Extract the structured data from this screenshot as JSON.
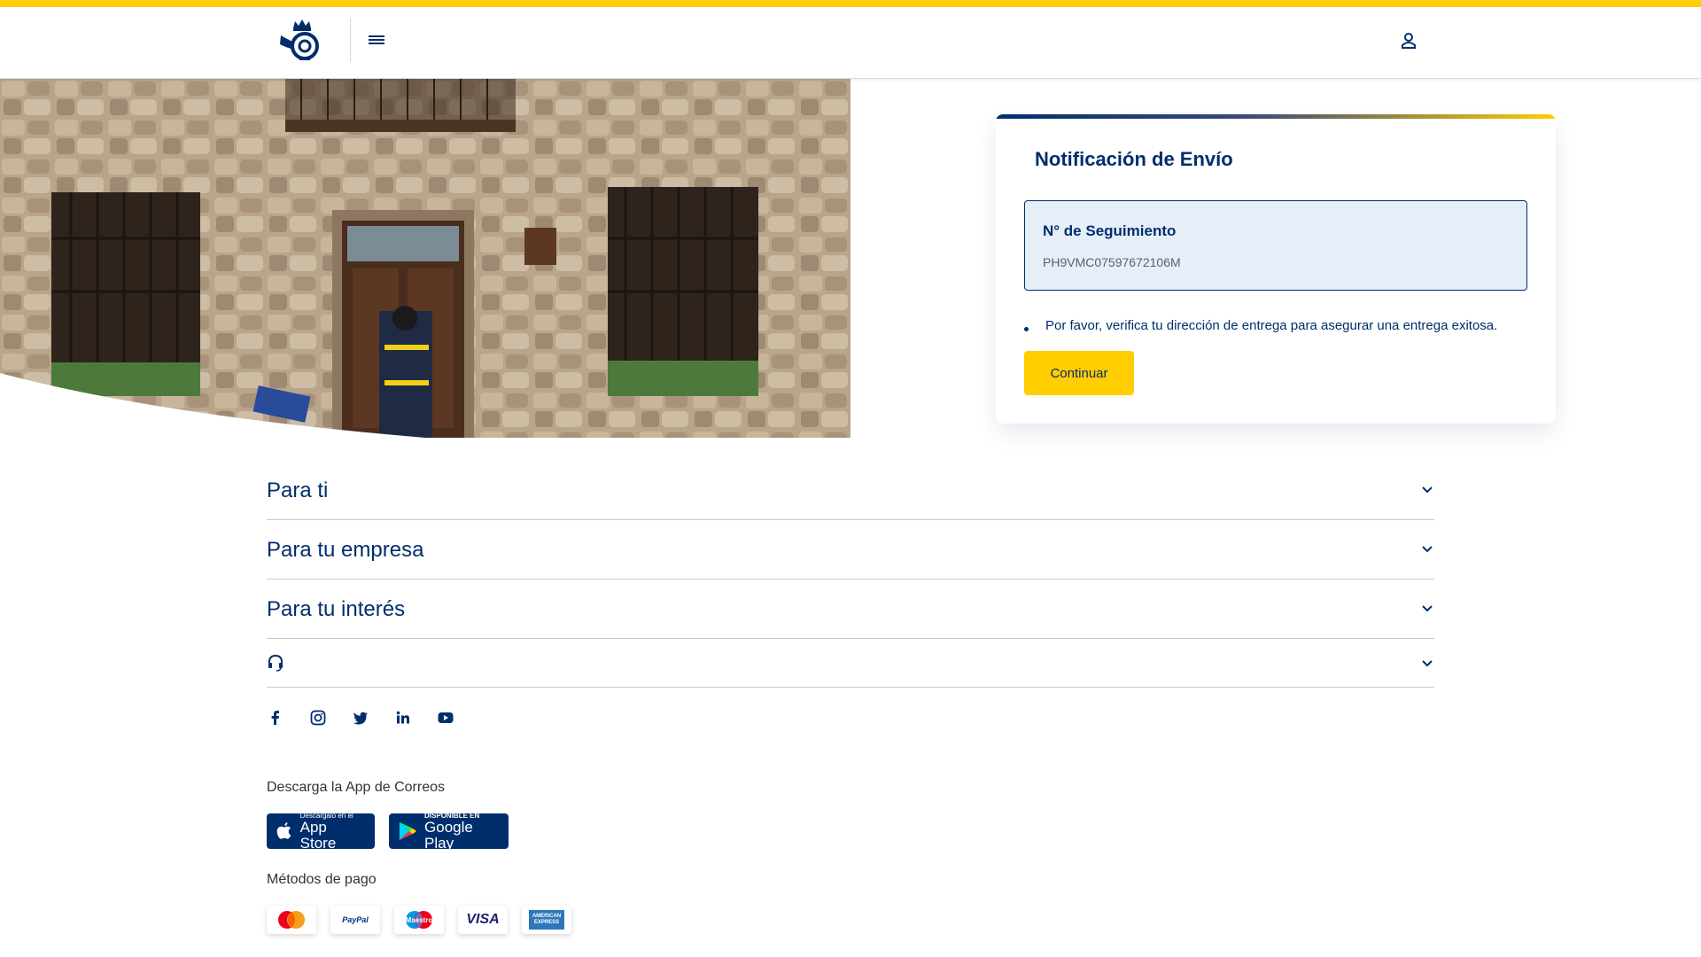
{
  "colors": {
    "brand_yellow": "#ffcd00",
    "brand_blue": "#002e6d",
    "track_box_bg": "#e6eef8"
  },
  "header": {
    "logo_icon": "correos-logo-icon",
    "menu_icon": "hamburger-menu-icon",
    "user_icon": "user-account-icon"
  },
  "hero": {
    "image": "postman-at-stone-house-door"
  },
  "card": {
    "title": "Notificación de Envío",
    "tracking_label": "N° de Seguimiento",
    "tracking_number": "PH9VMC07597672106M",
    "notice": "Por favor, verifica tu dirección de entrega para asegurar una entrega exitosa.",
    "continue_label": "Continuar"
  },
  "footer": {
    "sections": [
      {
        "label": "Para ti"
      },
      {
        "label": "Para tu empresa"
      },
      {
        "label": "Para tu interés"
      }
    ],
    "support_icon": "headset-icon",
    "socials": [
      "facebook-icon",
      "instagram-icon",
      "twitter-icon",
      "linkedin-icon",
      "youtube-icon"
    ],
    "app_title": "Descarga la App de Correos",
    "app_store": {
      "small": "Descárgalo en el",
      "big": "App Store"
    },
    "google_play": {
      "small": "DISPONIBLE EN",
      "big": "Google Play"
    },
    "payments_title": "Métodos de pago",
    "payments": {
      "paypal": "PayPal",
      "maestro": "Maestro",
      "visa": "VISA",
      "amex_1": "AMERICAN",
      "amex_2": "EXPRESS"
    }
  }
}
